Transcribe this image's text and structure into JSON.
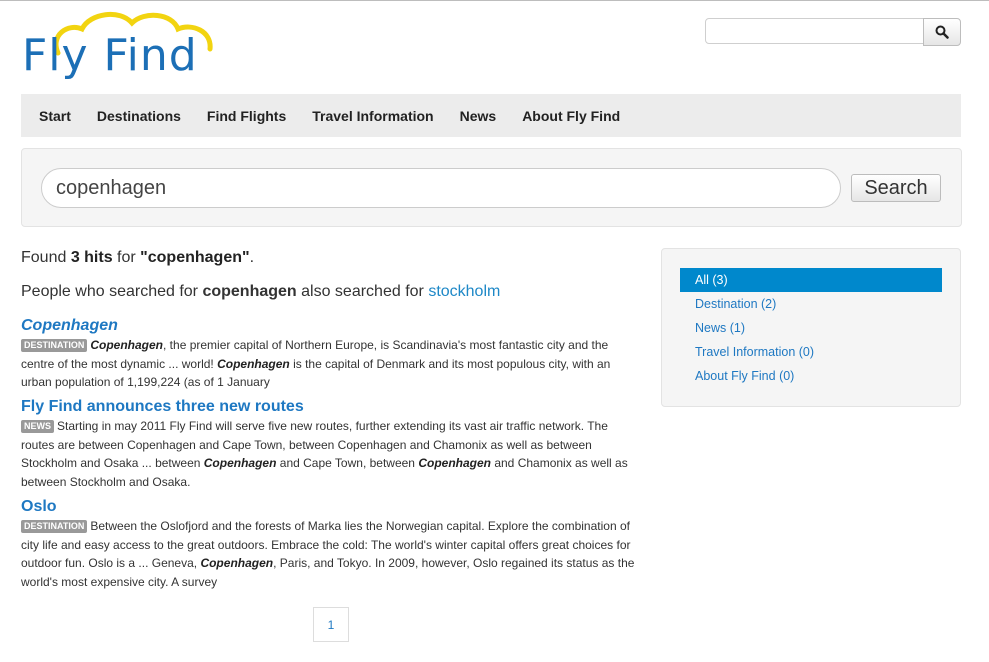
{
  "logo": {
    "text": "Fly Find"
  },
  "header_search": {
    "value": "",
    "button_icon": "search-icon"
  },
  "nav": {
    "items": [
      {
        "label": "Start"
      },
      {
        "label": "Destinations"
      },
      {
        "label": "Find Flights"
      },
      {
        "label": "Travel Information"
      },
      {
        "label": "News"
      },
      {
        "label": "About Fly Find"
      }
    ]
  },
  "search": {
    "query": "copenhagen",
    "button_label": "Search"
  },
  "summary": {
    "found_prefix": "Found ",
    "hit_count": "3 hits",
    "found_middle": " for ",
    "query_quoted": "\"copenhagen\"",
    "found_suffix": ".",
    "also_prefix": "People who searched for ",
    "also_query": "copenhagen",
    "also_middle": " also searched for ",
    "also_link": "stockholm"
  },
  "results": [
    {
      "title": "Copenhagen",
      "badge": "DESTINATION",
      "s1": "Copenhagen",
      "s2": ", the premier capital of Northern Europe, is Scandinavia's most fantastic city and the centre of the most dynamic ... world! ",
      "s3": "Copenhagen",
      "s4": " is the capital of Denmark and its most populous city, with an urban population of 1,199,224 (as of 1 January"
    },
    {
      "title": "Fly Find announces three new routes",
      "badge": "NEWS",
      "s1": "Starting in may 2011 Fly Find will serve five new routes, further extending its vast air traffic network. The routes are between Copenhagen and Cape Town, between Copenhagen and Chamonix as well as between Stockholm and Osaka ... between ",
      "s2": "Copenhagen",
      "s3": " and Cape Town, between ",
      "s4": "Copenhagen",
      "s5": " and Chamonix as well as between Stockholm and Osaka."
    },
    {
      "title": "Oslo",
      "badge": "DESTINATION",
      "s1": "Between the Oslofjord and the forests of Marka lies the Norwegian capital. Explore the combination of city life and easy access to the great outdoors. Embrace the cold: The world's winter capital offers great choices for outdoor fun. Oslo is a ... Geneva, ",
      "s2": "Copenhagen",
      "s3": ", Paris, and Tokyo. In 2009, however, Oslo regained its status as the world's most expensive city. A survey"
    }
  ],
  "facets": [
    {
      "label": "All (3)",
      "active": true
    },
    {
      "label": "Destination (2)"
    },
    {
      "label": "News (1)"
    },
    {
      "label": "Travel Information (0)"
    },
    {
      "label": "About Fly Find (0)"
    }
  ],
  "pagination": {
    "current": "1"
  },
  "colors": {
    "brand_blue": "#1c6fb6",
    "link": "#1e78c2",
    "active_facet": "#0088cc",
    "cloud_yellow": "#f2d410",
    "badge_gray": "#999999"
  }
}
